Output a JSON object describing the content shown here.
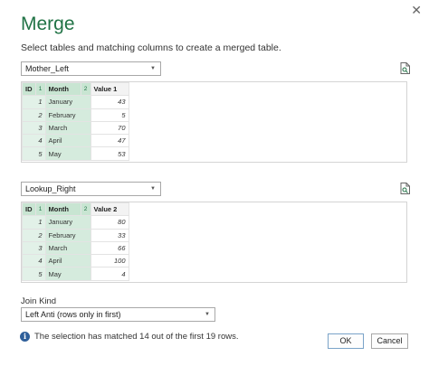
{
  "dialog": {
    "title": "Merge",
    "subtitle": "Select tables and matching columns to create a merged table."
  },
  "icons": {
    "close": "close-icon",
    "preview": "document-preview-icon",
    "info": "info-icon",
    "dropdown": "chevron-down-icon"
  },
  "colors": {
    "accent": "#217346",
    "selection": "#c8e5d2",
    "info": "#2f5f9a"
  },
  "table1": {
    "selected": "Mother_Left",
    "headers": {
      "id": "ID",
      "id_order": "1",
      "month": "Month",
      "month_order": "2",
      "value": "Value 1"
    },
    "rows": [
      {
        "id": "1",
        "month": "January",
        "value": "43"
      },
      {
        "id": "2",
        "month": "February",
        "value": "5"
      },
      {
        "id": "3",
        "month": "March",
        "value": "70"
      },
      {
        "id": "4",
        "month": "April",
        "value": "47"
      },
      {
        "id": "5",
        "month": "May",
        "value": "53"
      }
    ]
  },
  "table2": {
    "selected": "Lookup_Right",
    "headers": {
      "id": "ID",
      "id_order": "1",
      "month": "Month",
      "month_order": "2",
      "value": "Value 2"
    },
    "rows": [
      {
        "id": "1",
        "month": "January",
        "value": "80"
      },
      {
        "id": "2",
        "month": "February",
        "value": "33"
      },
      {
        "id": "3",
        "month": "March",
        "value": "66"
      },
      {
        "id": "4",
        "month": "April",
        "value": "100"
      },
      {
        "id": "5",
        "month": "May",
        "value": "4"
      }
    ]
  },
  "join": {
    "label": "Join Kind",
    "selected": "Left Anti (rows only in first)"
  },
  "status": "The selection has matched 14 out of the first 19 rows.",
  "buttons": {
    "ok": "OK",
    "cancel": "Cancel"
  }
}
